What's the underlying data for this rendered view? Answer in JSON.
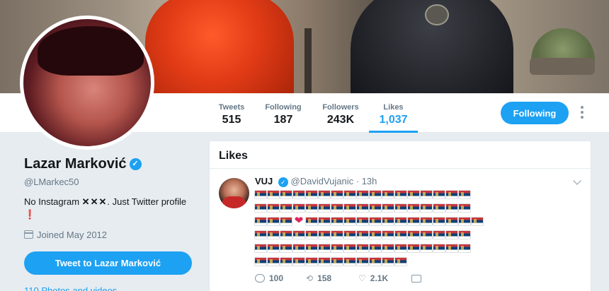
{
  "profile": {
    "name": "Lazar Marković",
    "verified_badge": "✓",
    "handle": "@LMarkec50",
    "bio_prefix": "No Instagram",
    "bio_crosses": "✕✕✕",
    "bio_suffix": ". Just Twitter profile",
    "bio_mark": "❗",
    "joined": "Joined May 2012",
    "tweet_to_label": "Tweet to Lazar Marković",
    "photos_link": "110 Photos and videos"
  },
  "stats": [
    {
      "label": "Tweets",
      "value": "515"
    },
    {
      "label": "Following",
      "value": "187"
    },
    {
      "label": "Followers",
      "value": "243K"
    },
    {
      "label": "Likes",
      "value": "1,037",
      "active": true
    }
  ],
  "actions": {
    "follow_label": "Following"
  },
  "likes_panel": {
    "title": "Likes",
    "tweet": {
      "author_name": "VUJ",
      "verified_badge": "✓",
      "author_handle": "@DavidVujanic",
      "separator": " · ",
      "time": "13h",
      "content": {
        "icon": "serbia-flag-icon",
        "rows": [
          17,
          17,
          17,
          17,
          17,
          12
        ],
        "heart_position": {
          "row": 3,
          "after_flag": 3
        },
        "heart_icon": "red-heart-icon"
      },
      "replies": "100",
      "retweets": "158",
      "likes": "2.1K"
    }
  },
  "colors": {
    "accent": "#1da1f2",
    "background": "#e6ecf0",
    "flag_red": "#c6363c",
    "flag_blue": "#0c4076",
    "heart": "#e0245e"
  }
}
